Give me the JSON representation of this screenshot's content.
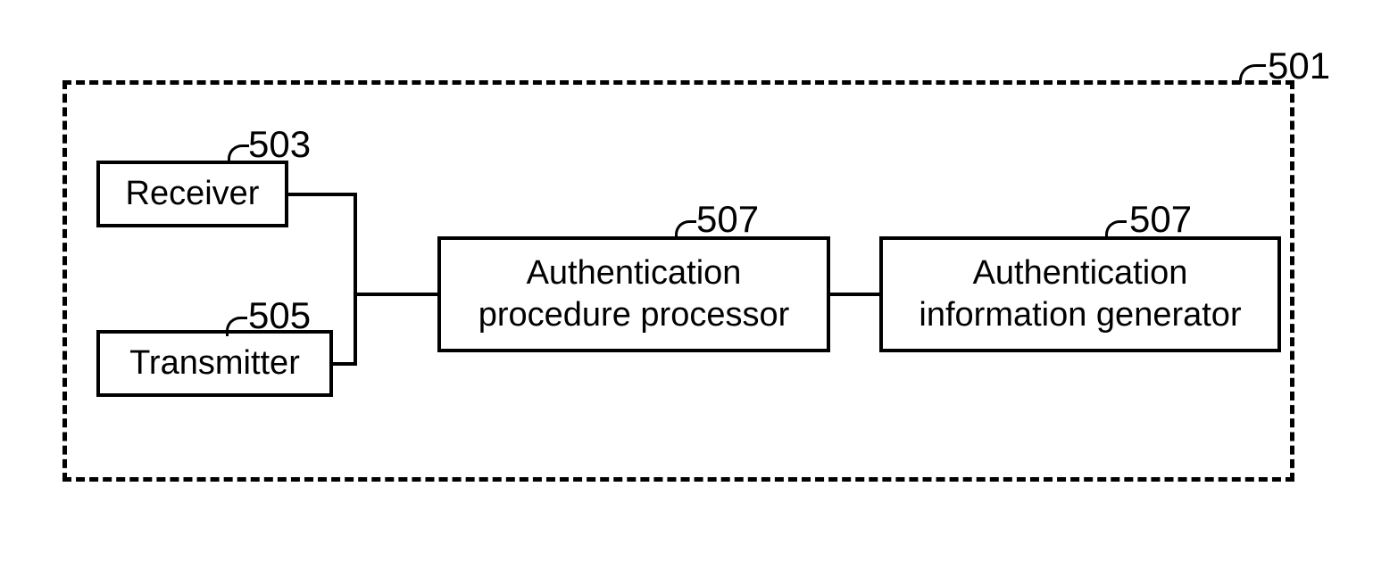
{
  "container": {
    "ref": "501"
  },
  "blocks": {
    "receiver": {
      "label": "Receiver",
      "ref": "503"
    },
    "transmitter": {
      "label": "Transmitter",
      "ref": "505"
    },
    "processor": {
      "label": "Authentication\nprocedure processor",
      "ref": "507"
    },
    "generator": {
      "label": "Authentication\ninformation generator",
      "ref": "507"
    }
  },
  "chart_data": {
    "type": "diagram",
    "title": "",
    "nodes": [
      {
        "id": "501",
        "label": "",
        "shape": "dashed-container"
      },
      {
        "id": "503",
        "label": "Receiver"
      },
      {
        "id": "505",
        "label": "Transmitter"
      },
      {
        "id": "507a",
        "ref": "507",
        "label": "Authentication procedure processor"
      },
      {
        "id": "507b",
        "ref": "507",
        "label": "Authentication information generator"
      }
    ],
    "edges": [
      {
        "from": "503",
        "to": "507a"
      },
      {
        "from": "505",
        "to": "507a"
      },
      {
        "from": "507a",
        "to": "507b"
      }
    ]
  }
}
